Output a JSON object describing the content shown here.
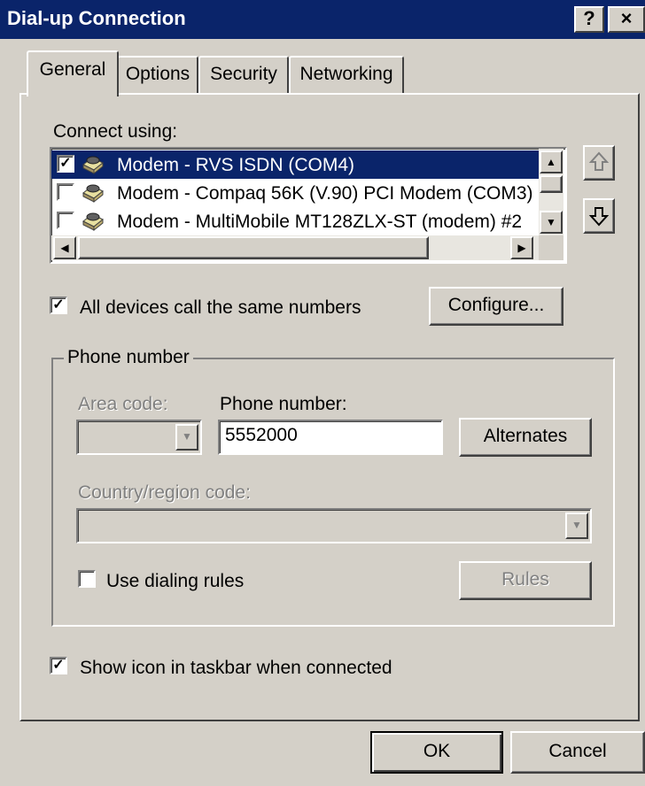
{
  "window": {
    "title": "Dial-up Connection",
    "help_label": "?",
    "close_label": "×"
  },
  "tabs": [
    {
      "label": "General",
      "active": true
    },
    {
      "label": "Options",
      "active": false
    },
    {
      "label": "Security",
      "active": false
    },
    {
      "label": "Networking",
      "active": false
    }
  ],
  "general": {
    "connect_using_label": "Connect using:",
    "devices": [
      {
        "label": "Modem - RVS ISDN (COM4)",
        "checked": true,
        "selected": true
      },
      {
        "label": "Modem - Compaq 56K (V.90) PCI Modem (COM3)",
        "checked": false,
        "selected": false
      },
      {
        "label": "Modem - MultiMobile MT128ZLX-ST (modem) #2",
        "checked": false,
        "selected": false
      }
    ],
    "same_numbers_label": "All devices call the same numbers",
    "same_numbers_checked": true,
    "configure_label": "Configure...",
    "phone_group_label": "Phone number",
    "area_code_label": "Area code:",
    "area_code_value": "",
    "phone_number_label": "Phone number:",
    "phone_number_value": "5552000",
    "alternates_label": "Alternates",
    "country_label": "Country/region code:",
    "country_value": "",
    "dialing_rules_label": "Use dialing rules",
    "dialing_rules_checked": false,
    "rules_label": "Rules",
    "show_icon_label": "Show icon in taskbar when connected",
    "show_icon_checked": true
  },
  "footer": {
    "ok_label": "OK",
    "cancel_label": "Cancel"
  },
  "colors": {
    "title_bar": "#0a246a",
    "face": "#d4d0c8",
    "selection": "#0a246a"
  }
}
